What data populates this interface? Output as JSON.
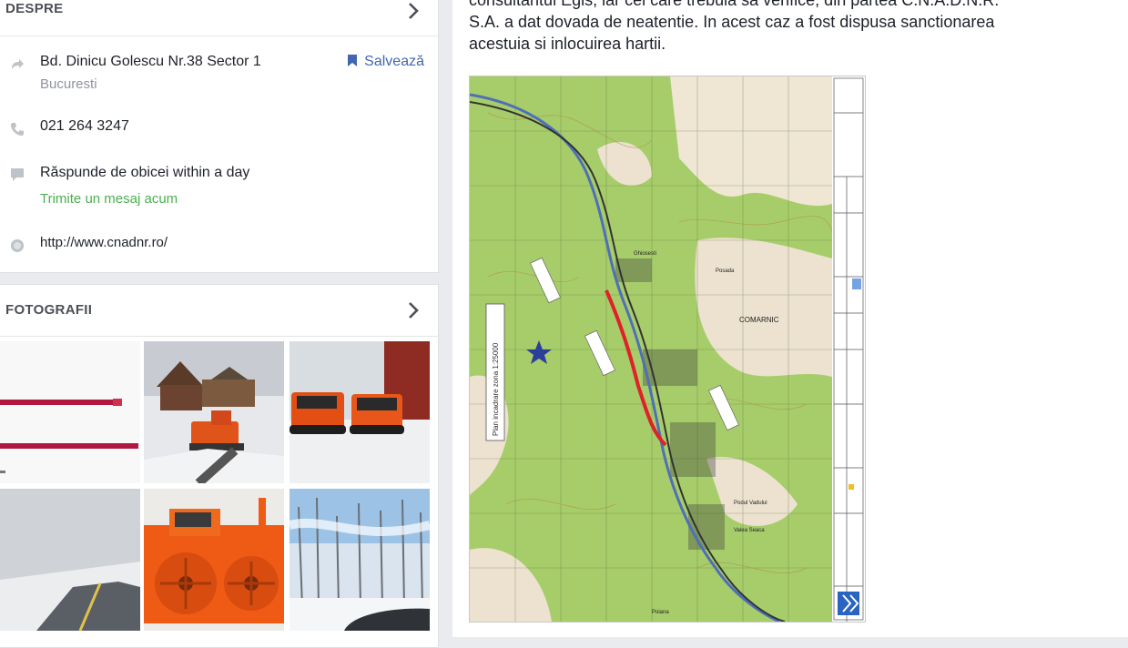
{
  "about": {
    "title": "DESPRE",
    "address_line1": "Bd. Dinicu Golescu Nr.38 Sector 1",
    "address_city": "Bucuresti",
    "save_label": "Salvează",
    "phone": "021 264 3247",
    "response_text": "Răspunde de obicei within a day",
    "message_link": "Trimite un mesaj acum",
    "website": "http://www.cnadnr.ro/"
  },
  "photos": {
    "title": "FOTOGRAFII"
  },
  "post": {
    "line1": "consultantul Egis, iar cel care trebuia sa verifice, din partea C.N.A.D.N.R.",
    "line2": "S.A. a dat dovada de neatentie. In acest caz a fost dispusa sanctionarea",
    "line3": "acestuia si inlocuirea hartii."
  },
  "map": {
    "labels": [
      "Plan incadrare zona 1:25000",
      "COMARNIC",
      "Posada",
      "Ghiosesti",
      "Podul Vadului",
      "Valea Seaca",
      "Poiana"
    ]
  },
  "colors": {
    "route_red": "#e0202a",
    "link_blue": "#4267b2",
    "message_green": "#4caf50",
    "snow_plow_orange": "#f25a12",
    "map_green": "#a7cd6a"
  },
  "icons": [
    "chevron-right-icon",
    "share-arrow-icon",
    "phone-icon",
    "message-icon",
    "globe-icon",
    "bookmark-icon"
  ]
}
